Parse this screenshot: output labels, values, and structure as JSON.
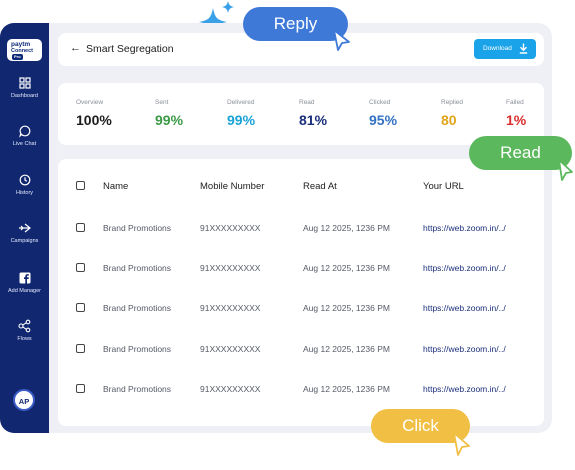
{
  "sidebar": {
    "logo_brand": "paytm",
    "logo_product": "Connect",
    "logo_badge": "Pro",
    "items": [
      {
        "label": "Dashboard",
        "icon": "grid-icon"
      },
      {
        "label": "Live Chat",
        "icon": "chat-bubble-icon"
      },
      {
        "label": "History",
        "icon": "history-icon"
      },
      {
        "label": "Campaigns",
        "icon": "plane-icon"
      },
      {
        "label": "Add Manager",
        "icon": "facebook-icon"
      },
      {
        "label": "Flows",
        "icon": "flows-icon"
      }
    ],
    "avatar_initials": "AP"
  },
  "header": {
    "title": "Smart Segregation",
    "download_label": "Download"
  },
  "stats": [
    {
      "label": "Overview",
      "value": "100%",
      "color": "#1d1d1d"
    },
    {
      "label": "Sent",
      "value": "99%",
      "color": "#3a9a45"
    },
    {
      "label": "Delivered",
      "value": "99%",
      "color": "#1aa3d8"
    },
    {
      "label": "Read",
      "value": "81%",
      "color": "#1b2f7a"
    },
    {
      "label": "Clicked",
      "value": "95%",
      "color": "#3372c4"
    },
    {
      "label": "Replied",
      "value": "80",
      "color": "#e0a419"
    },
    {
      "label": "Failed",
      "value": "1%",
      "color": "#d92d2d"
    }
  ],
  "table": {
    "columns": [
      "Name",
      "Mobile Number",
      "Read At",
      "Your URL"
    ],
    "rows": [
      [
        "Brand Promotions",
        "91XXXXXXXXX",
        "Aug 12 2025, 1236 PM",
        "https://web.zoom.in/../"
      ],
      [
        "Brand Promotions",
        "91XXXXXXXXX",
        "Aug 12 2025, 1236 PM",
        "https://web.zoom.in/../"
      ],
      [
        "Brand Promotions",
        "91XXXXXXXXX",
        "Aug 12 2025, 1236 PM",
        "https://web.zoom.in/../"
      ],
      [
        "Brand Promotions",
        "91XXXXXXXXX",
        "Aug 12 2025, 1236 PM",
        "https://web.zoom.in/../"
      ],
      [
        "Brand Promotions",
        "91XXXXXXXXX",
        "Aug 12 2025, 1236 PM",
        "https://web.zoom.in/../"
      ]
    ]
  },
  "badges": {
    "reply": "Reply",
    "read": "Read",
    "click": "Click"
  }
}
